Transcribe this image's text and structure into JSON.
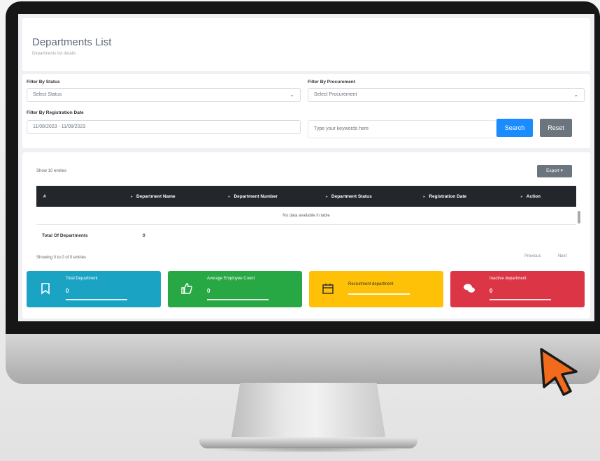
{
  "header": {
    "title": "Departments List",
    "subtitle": "Departments list details"
  },
  "filters": {
    "status_label": "Filter By Status",
    "status_value": "Select Status",
    "procurement_label": "Filter By Procurement",
    "procurement_value": "Select Procurement",
    "date_label": "Filter By Registration Date",
    "date_value": "11/08/2023 - 11/08/2023",
    "search_placeholder": "Type your keywords here",
    "search_label": "Search",
    "reset_label": "Reset"
  },
  "table": {
    "show_entries": "Show 10 entries",
    "export_label": "Export",
    "columns": [
      "#",
      "Department Name",
      "Department Number",
      "Department Status",
      "Registration Date",
      "Action"
    ],
    "empty_text": "No data available in table",
    "total_label": "Total Of Departments",
    "total_value": "0",
    "showing_text": "Showing 0 to 0 of 0 entries",
    "prev_label": "Previous",
    "next_label": "Next"
  },
  "stats": [
    {
      "title": "Total Department",
      "value": "0",
      "color": "#1ba3c4",
      "icon": "bookmark-icon"
    },
    {
      "title": "Average Employee Count",
      "value": "0",
      "color": "#28a745",
      "icon": "thumbs-up-icon"
    },
    {
      "title": "Recruitment department",
      "value": "",
      "color": "#ffc107",
      "icon": "calendar-icon"
    },
    {
      "title": "Inactive department",
      "value": "0",
      "color": "#dc3545",
      "icon": "chat-icon"
    }
  ]
}
